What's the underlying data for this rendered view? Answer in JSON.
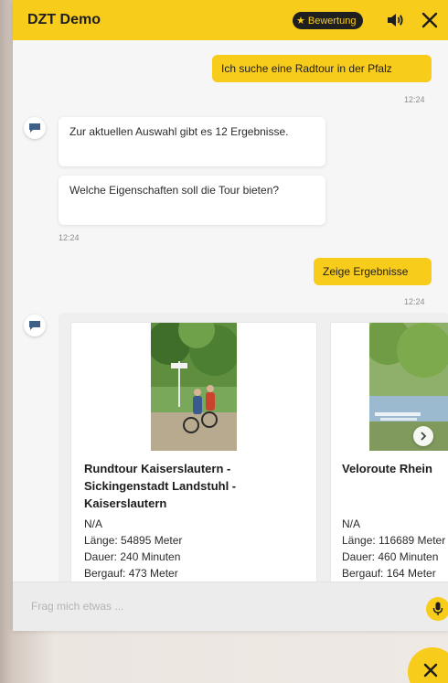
{
  "header": {
    "title": "DZT Demo",
    "rating_label": "Bewertung",
    "sound_icon": "speaker-icon",
    "close_icon": "close-icon"
  },
  "messages": {
    "user1": {
      "text": "Ich suche eine Radtour in der Pfalz",
      "time": "12:24"
    },
    "bot1": {
      "text": "Zur aktuellen Auswahl gibt es 12 Ergebnisse."
    },
    "bot2": {
      "text": "Welche Eigenschaften soll die Tour bieten?",
      "time": "12:24"
    },
    "user2": {
      "text": "Zeige Ergebnisse",
      "time": "12:24"
    }
  },
  "cards": [
    {
      "name": "Rundtour Kaiserslautern - Sickingenstadt Landstuhl - Kaiserslautern",
      "rating": "N/A",
      "length": "Länge: 54895 Meter",
      "duration": "Dauer: 240 Minuten",
      "ascent": "Bergauf: 473 Meter"
    },
    {
      "name": "Veloroute Rhein",
      "rating": "N/A",
      "length": "Länge: 116689 Meter",
      "duration": "Dauer: 460 Minuten",
      "ascent": "Bergauf: 164 Meter"
    }
  ],
  "input": {
    "placeholder": "Frag mich etwas ..."
  },
  "colors": {
    "accent": "#f8cc1b",
    "dark": "#1f1f1f"
  }
}
